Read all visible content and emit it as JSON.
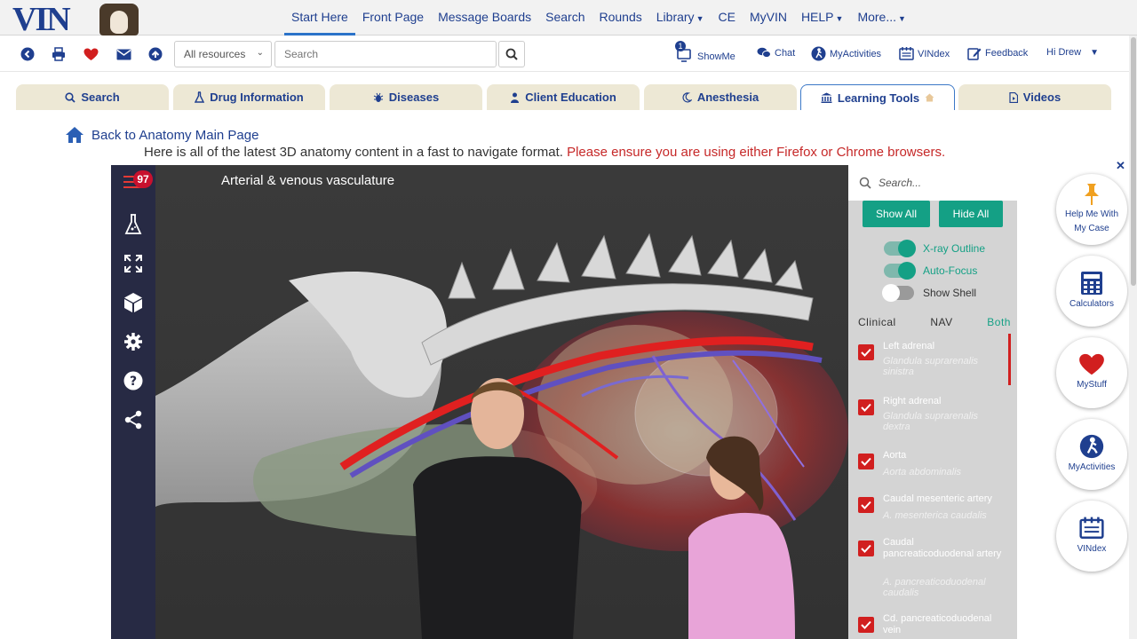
{
  "nav": {
    "logo_text": "VIN",
    "links": [
      {
        "label": "Start Here",
        "active": true,
        "caret": false
      },
      {
        "label": "Front Page",
        "caret": false
      },
      {
        "label": "Message Boards",
        "caret": false
      },
      {
        "label": "Search",
        "caret": false
      },
      {
        "label": "Rounds",
        "caret": false
      },
      {
        "label": "Library",
        "caret": true
      },
      {
        "label": "CE",
        "caret": false
      },
      {
        "label": "MyVIN",
        "caret": false
      },
      {
        "label": "HELP",
        "caret": true
      },
      {
        "label": "More...",
        "caret": true
      }
    ]
  },
  "toolbar": {
    "resource_select": "All resources",
    "search_placeholder": "Search",
    "showme_badge": "1",
    "showme": "ShowMe",
    "chat": "Chat",
    "myactivities": "MyActivities",
    "vindex": "VINdex",
    "feedback": "Feedback",
    "user": "Hi Drew"
  },
  "tabs": [
    {
      "label": "Search"
    },
    {
      "label": "Drug Information"
    },
    {
      "label": "Diseases"
    },
    {
      "label": "Client Education"
    },
    {
      "label": "Anesthesia"
    },
    {
      "label": "Learning Tools",
      "active": true
    },
    {
      "label": "Videos"
    }
  ],
  "back_link": "Back to Anatomy Main Page",
  "intro": {
    "text": "Here is all of the latest 3D anatomy content in a fast to navigate format.",
    "warning": "Please ensure you are using either Firefox or Chrome browsers."
  },
  "viewer": {
    "badge": "97",
    "title": "Arterial & venous vasculature",
    "panel": {
      "search_placeholder": "Search...",
      "show_all": "Show All",
      "hide_all": "Hide All",
      "toggles": [
        {
          "label": "X-ray Outline",
          "on": true
        },
        {
          "label": "Auto-Focus",
          "on": true
        },
        {
          "label": "Show Shell",
          "on": false
        }
      ],
      "modes": [
        "Clinical",
        "NAV",
        "Both"
      ],
      "selected_mode": "Both",
      "items": [
        {
          "name": "Left adrenal",
          "latin": "Glandula suprarenalis sinistra"
        },
        {
          "name": "Right adrenal",
          "latin": "Glandula suprarenalis dextra"
        },
        {
          "name": "Aorta",
          "latin": "Aorta abdominalis"
        },
        {
          "name": "Caudal mesenteric artery",
          "latin": "A. mesenterica caudalis"
        },
        {
          "name": "Caudal pancreaticoduodenal artery",
          "latin": "A. pancreaticoduodenal caudalis"
        },
        {
          "name": "Cd. pancreaticoduodenal vein",
          "latin": ""
        }
      ]
    }
  },
  "floating": [
    {
      "label": "Help Me With My Case",
      "icon": "pin-icon"
    },
    {
      "label": "Calculators",
      "icon": "calculator-icon"
    },
    {
      "label": "MyStuff",
      "icon": "heart-icon"
    },
    {
      "label": "MyActivities",
      "icon": "activity-icon"
    },
    {
      "label": "VINdex",
      "icon": "vindex-icon"
    }
  ],
  "colors": {
    "brand_blue": "#1f3f8f",
    "teal": "#14a085",
    "warning_red": "#c62828",
    "check_red": "#d11f1f",
    "tab_bg": "#ede8d5",
    "viewer_sidebar": "#272a44"
  }
}
